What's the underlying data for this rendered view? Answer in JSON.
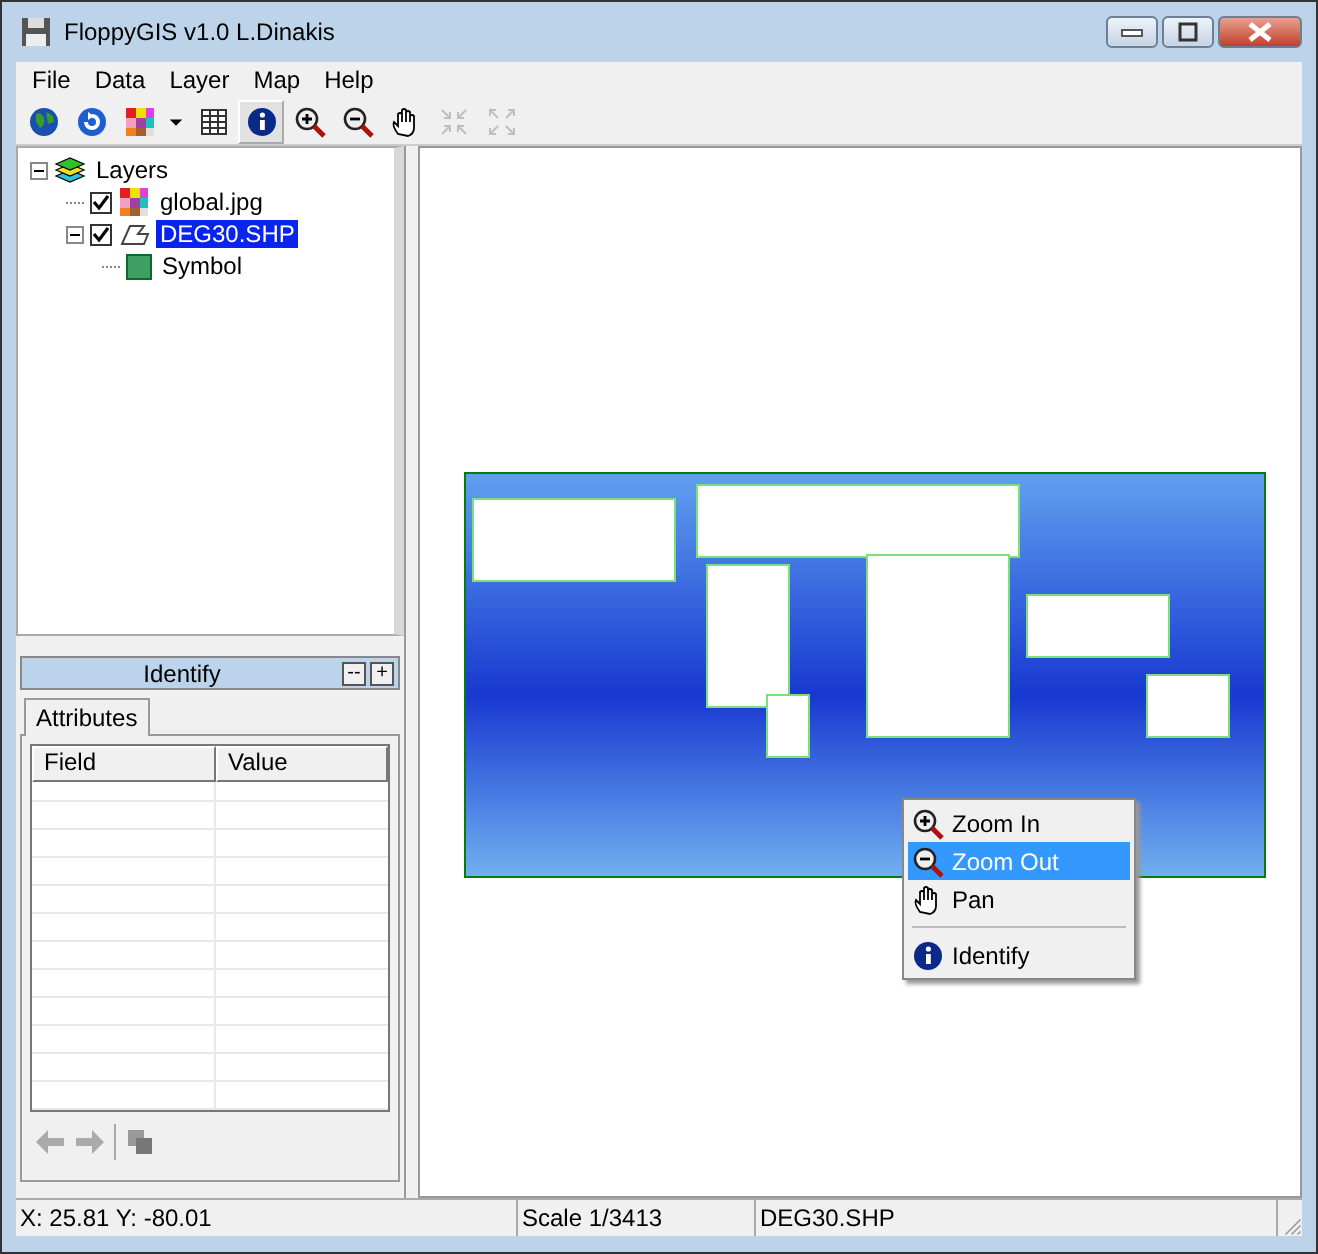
{
  "window": {
    "title": "FloppyGIS v1.0 L.Dinakis"
  },
  "menu": [
    {
      "label": "File"
    },
    {
      "label": "Data"
    },
    {
      "label": "Layer"
    },
    {
      "label": "Map"
    },
    {
      "label": "Help"
    }
  ],
  "toolbar": [
    {
      "kind": "globe",
      "selected": false,
      "disabled": false
    },
    {
      "kind": "refresh",
      "selected": false,
      "disabled": false
    },
    {
      "kind": "palette",
      "selected": false,
      "disabled": false
    },
    {
      "kind": "dropdown",
      "selected": false,
      "disabled": false
    },
    {
      "kind": "table",
      "selected": false,
      "disabled": false
    },
    {
      "kind": "info",
      "selected": true,
      "disabled": false
    },
    {
      "kind": "zoom-in",
      "selected": false,
      "disabled": false
    },
    {
      "kind": "zoom-out",
      "selected": false,
      "disabled": false
    },
    {
      "kind": "pan",
      "selected": false,
      "disabled": false
    },
    {
      "kind": "shrink",
      "selected": false,
      "disabled": true
    },
    {
      "kind": "expand",
      "selected": false,
      "disabled": true
    }
  ],
  "tree": [
    {
      "label": "Layers",
      "kind": "group",
      "expanded": true,
      "children": [
        {
          "label": "global.jpg",
          "kind": "image",
          "checked": true,
          "selected": false
        },
        {
          "label": "DEG30.SHP",
          "kind": "shape",
          "checked": true,
          "selected": true,
          "expanded": true,
          "children": [
            {
              "label": "Symbol",
              "kind": "symbol",
              "color": "#3f9f62"
            }
          ]
        }
      ]
    }
  ],
  "identify": {
    "title": "Identify",
    "buttons": [
      "--",
      "+"
    ],
    "tabs": [
      {
        "label": "Attributes",
        "selected": true
      }
    ],
    "table": {
      "columns": [
        "Field",
        "Value"
      ]
    },
    "nav": [
      {
        "kind": "back",
        "disabled": true
      },
      {
        "kind": "forward",
        "disabled": true
      },
      {
        "kind": "layers",
        "disabled": true
      }
    ]
  },
  "context_menu": [
    {
      "kind": "zoom-in",
      "label": "Zoom In",
      "selected": false
    },
    {
      "kind": "zoom-out",
      "label": "Zoom Out",
      "selected": true
    },
    {
      "kind": "pan",
      "label": "Pan",
      "selected": false
    },
    {
      "kind": "separator"
    },
    {
      "kind": "info",
      "label": "Identify",
      "selected": false
    }
  ],
  "status_bar": [
    "X: 25.81 Y: -80.01",
    "Scale 1/3413",
    "DEG30.SHP"
  ]
}
